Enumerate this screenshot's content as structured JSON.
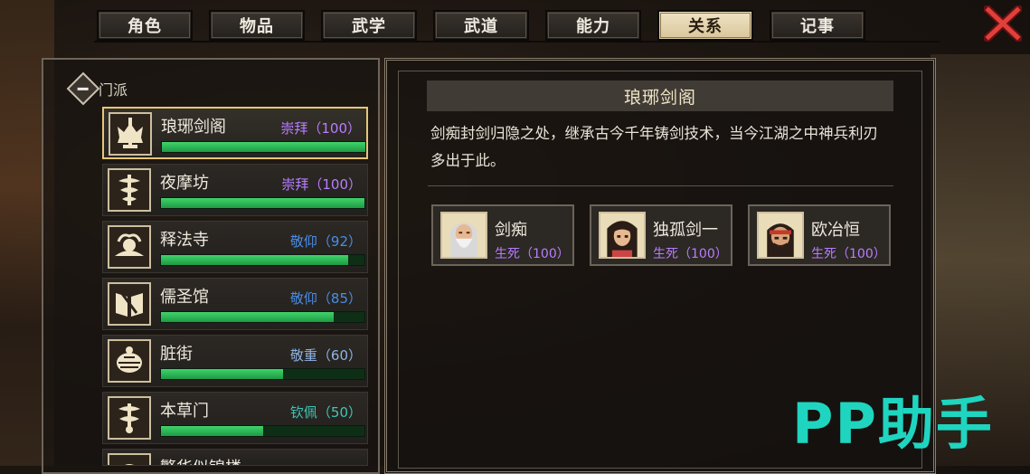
{
  "tabs": [
    {
      "label": "角色",
      "active": false
    },
    {
      "label": "物品",
      "active": false
    },
    {
      "label": "武学",
      "active": false
    },
    {
      "label": "武道",
      "active": false
    },
    {
      "label": "能力",
      "active": false
    },
    {
      "label": "关系",
      "active": true
    },
    {
      "label": "记事",
      "active": false
    }
  ],
  "close_icon": "red-x-close-icon",
  "faction_group": {
    "label": "门派",
    "toggle": "collapse-minus-icon"
  },
  "factions": [
    {
      "name": "琅琊剑阁",
      "status": "崇拜（100）",
      "status_color": "#b77dff",
      "progress": 1.0,
      "selected": true,
      "icon": "crown-sword-emblem-icon"
    },
    {
      "name": "夜摩坊",
      "status": "崇拜（100）",
      "status_color": "#b77dff",
      "progress": 1.0,
      "selected": false,
      "icon": "caduceus-emblem-icon"
    },
    {
      "name": "释法寺",
      "status": "敬仰（92）",
      "status_color": "#4a8de8",
      "progress": 0.92,
      "selected": false,
      "icon": "lotus-emblem-icon"
    },
    {
      "name": "儒圣馆",
      "status": "敬仰（85）",
      "status_color": "#4a8de8",
      "progress": 0.85,
      "selected": false,
      "icon": "book-emblem-icon"
    },
    {
      "name": "脏街",
      "status": "敬重（60）",
      "status_color": "#8fb4e6",
      "progress": 0.6,
      "selected": false,
      "icon": "shell-emblem-icon"
    },
    {
      "name": "本草门",
      "status": "钦佩（50）",
      "status_color": "#3ec6b6",
      "progress": 0.5,
      "selected": false,
      "icon": "herb-emblem-icon"
    },
    {
      "name": "繁华似锦楼",
      "status": "",
      "status_color": "#3ec6b6",
      "progress": 0.45,
      "selected": false,
      "icon": "flower-emblem-icon"
    }
  ],
  "detail": {
    "title": "琅琊剑阁",
    "description": "剑痴封剑归隐之处，继承古今千年铸剑技术，当今江湖之中神兵利刃多出于此。",
    "members": [
      {
        "name": "剑痴",
        "relation": "生死（100）",
        "avatar": "old-sage-portrait"
      },
      {
        "name": "独孤剑一",
        "relation": "生死（100）",
        "avatar": "long-hair-swordsman-portrait"
      },
      {
        "name": "欧冶恒",
        "relation": "生死（100）",
        "avatar": "headband-smith-portrait"
      }
    ]
  },
  "watermark": "PP助手"
}
